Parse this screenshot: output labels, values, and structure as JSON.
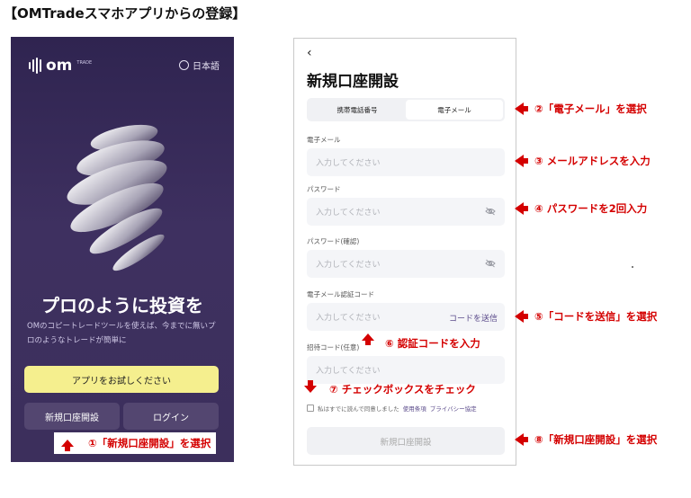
{
  "page_title": "【OMTradeスマホアプリからの登録】",
  "left_screen": {
    "logo_text": "om",
    "logo_sub": "TRADE",
    "language": "日本語",
    "headline": "プロのように投資を",
    "subtext": "OMのコピートレードツールを使えば、今までに無いプロのようなトレードが簡単に",
    "try_button": "アプリをお試しください",
    "signup_button": "新規口座開設",
    "login_button": "ログイン"
  },
  "right_screen": {
    "back": "‹",
    "title": "新規口座開設",
    "tabs": [
      "携帯電話番号",
      "電子メール"
    ],
    "email_label": "電子メール",
    "email_placeholder": "入力してください",
    "password_label": "パスワード",
    "password_placeholder": "入力してください",
    "confirm_label": "パスワード(確認)",
    "confirm_placeholder": "入力してください",
    "code_label": "電子メール認証コード",
    "code_placeholder": "入力してください",
    "send_code": "コードを送信",
    "invite_label": "招待コード(任意)",
    "invite_placeholder": "入力してください",
    "agree_text": "私はすでに読んで同意しました",
    "terms_link": "使用条項",
    "privacy_link": "プライバシー協定",
    "submit_button": "新規口座開設"
  },
  "annotations": {
    "step1": "①「新規口座開設」を選択",
    "step2": "②「電子メール」を選択",
    "step3": "③ メールアドレスを入力",
    "step4": "④ パスワードを2回入力",
    "step5": "⑤「コードを送信」を選択",
    "step6": "⑥ 認証コードを入力",
    "step7": "⑦ チェックボックスをチェック",
    "step8": "⑧「新規口座開設」を選択"
  },
  "colors": {
    "annotation_red": "#d40000",
    "left_bg": "#3d2f5f",
    "try_button_bg": "#f5ef8e",
    "accent_link": "#5a4a8a"
  }
}
